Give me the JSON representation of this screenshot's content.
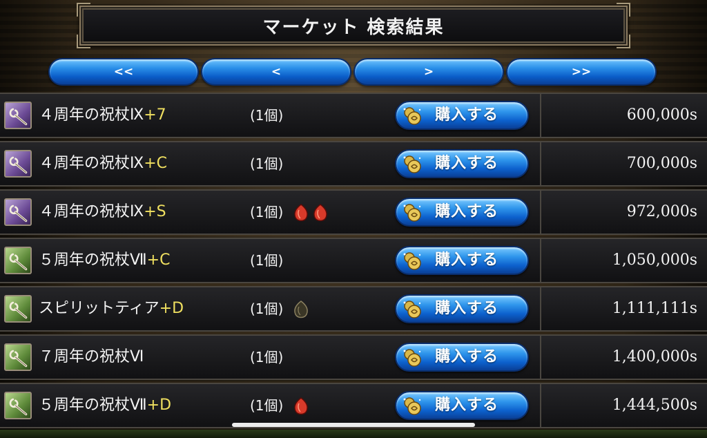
{
  "title": "マーケット 検索結果",
  "nav": {
    "first": "<<",
    "prev": "<",
    "next": ">",
    "last": ">>"
  },
  "buy_label": "購入する",
  "rows": [
    {
      "name": "４周年の祝杖Ⅸ",
      "enh": "+7",
      "qty": "(1個)",
      "price": "600,000s",
      "icon": "staff-icon",
      "icon_color": "purple",
      "gems": []
    },
    {
      "name": "４周年の祝杖Ⅸ",
      "enh": "+C",
      "qty": "(1個)",
      "price": "700,000s",
      "icon": "staff-icon",
      "icon_color": "purple",
      "gems": []
    },
    {
      "name": "４周年の祝杖Ⅸ",
      "enh": "+S",
      "qty": "(1個)",
      "price": "972,000s",
      "icon": "staff-icon",
      "icon_color": "purple",
      "gems": [
        "red-gem-icon",
        "red-gem-icon"
      ]
    },
    {
      "name": "５周年の祝杖Ⅶ",
      "enh": "+C",
      "qty": "(1個)",
      "price": "1,050,000s",
      "icon": "staff-icon",
      "icon_color": "green",
      "gems": []
    },
    {
      "name": "スピリットティア",
      "enh": "+D",
      "qty": "(1個)",
      "price": "1,111,111s",
      "icon": "staff-icon",
      "icon_color": "green",
      "gems": [
        "dark-gem-icon"
      ]
    },
    {
      "name": "７周年の祝杖Ⅵ",
      "enh": "",
      "qty": "(1個)",
      "price": "1,400,000s",
      "icon": "staff-icon",
      "icon_color": "green",
      "gems": []
    },
    {
      "name": "５周年の祝杖Ⅶ",
      "enh": "+D",
      "qty": "(1個)",
      "price": "1,444,500s",
      "icon": "staff-icon",
      "icon_color": "green",
      "gems": [
        "red-gem-icon"
      ]
    }
  ],
  "colors": {
    "enh_text": "#f0e060",
    "button_blue": "#2a8fe8",
    "red_gem": "#d83a2a",
    "dark_gem": "#6a6040"
  }
}
